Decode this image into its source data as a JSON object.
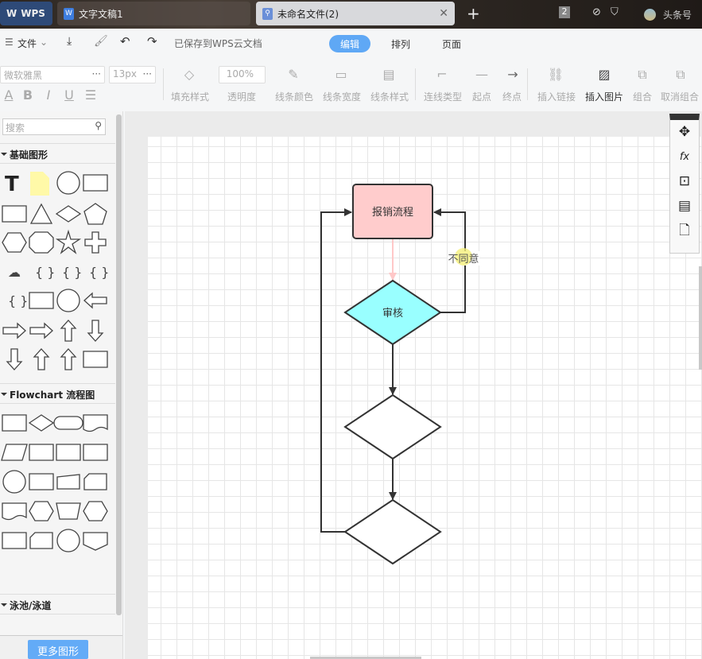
{
  "tabs": {
    "wps": "WPS",
    "doc": "文字文稿1",
    "current": "未命名文件(2)",
    "badge": "2",
    "user": "头条号"
  },
  "menu": {
    "file": "文件",
    "saved": "已保存到WPS云文档",
    "segments": [
      "编辑",
      "排列",
      "页面"
    ],
    "active": "编辑",
    "accent": "#5fa8f5"
  },
  "toolbar": {
    "font": "微软雅黑",
    "size": "13px",
    "opacity": "100%",
    "labels": [
      "填充样式",
      "透明度",
      "线条颜色",
      "线条宽度",
      "线条样式",
      "连线类型",
      "起点",
      "终点",
      "插入链接",
      "插入图片",
      "组合",
      "取消组合"
    ]
  },
  "sidebar": {
    "search_placeholder": "搜索",
    "sections": [
      "基础图形",
      "Flowchart 流程图",
      "泳池/泳道"
    ],
    "more": "更多图形"
  },
  "diagram": {
    "start": "报销流程",
    "review": "审核",
    "reject": "不同意",
    "colors": {
      "start": "#ffcccc",
      "review": "#99ffff"
    }
  }
}
